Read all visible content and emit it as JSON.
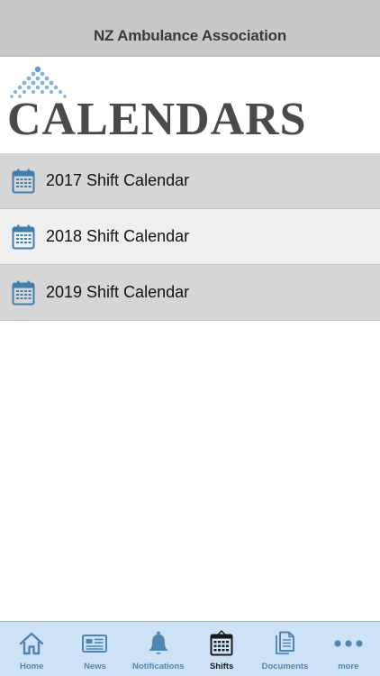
{
  "navbar": {
    "title": "NZ Ambulance Association"
  },
  "banner": {
    "title": "CALENDARS"
  },
  "calendars": [
    {
      "label": "2017 Shift Calendar"
    },
    {
      "label": "2018 Shift Calendar"
    },
    {
      "label": "2019 Shift Calendar"
    }
  ],
  "tabbar": {
    "tabs": [
      {
        "label": "Home",
        "icon": "home-icon"
      },
      {
        "label": "News",
        "icon": "newspaper-icon"
      },
      {
        "label": "Notifications",
        "icon": "bell-icon"
      },
      {
        "label": "Shifts",
        "icon": "calendar-icon",
        "active": true
      },
      {
        "label": "Documents",
        "icon": "documents-icon"
      },
      {
        "label": "more",
        "icon": "more-icon"
      }
    ]
  },
  "colors": {
    "navbar_bg": "#c8c8c8",
    "row_dark": "#d6d6d6",
    "row_light": "#efefef",
    "tabbar_bg": "#cde3f5",
    "tab_icon": "#4d86b2",
    "active_tab": "#1a1a1a",
    "logo_blue": "#6ea6dc"
  }
}
